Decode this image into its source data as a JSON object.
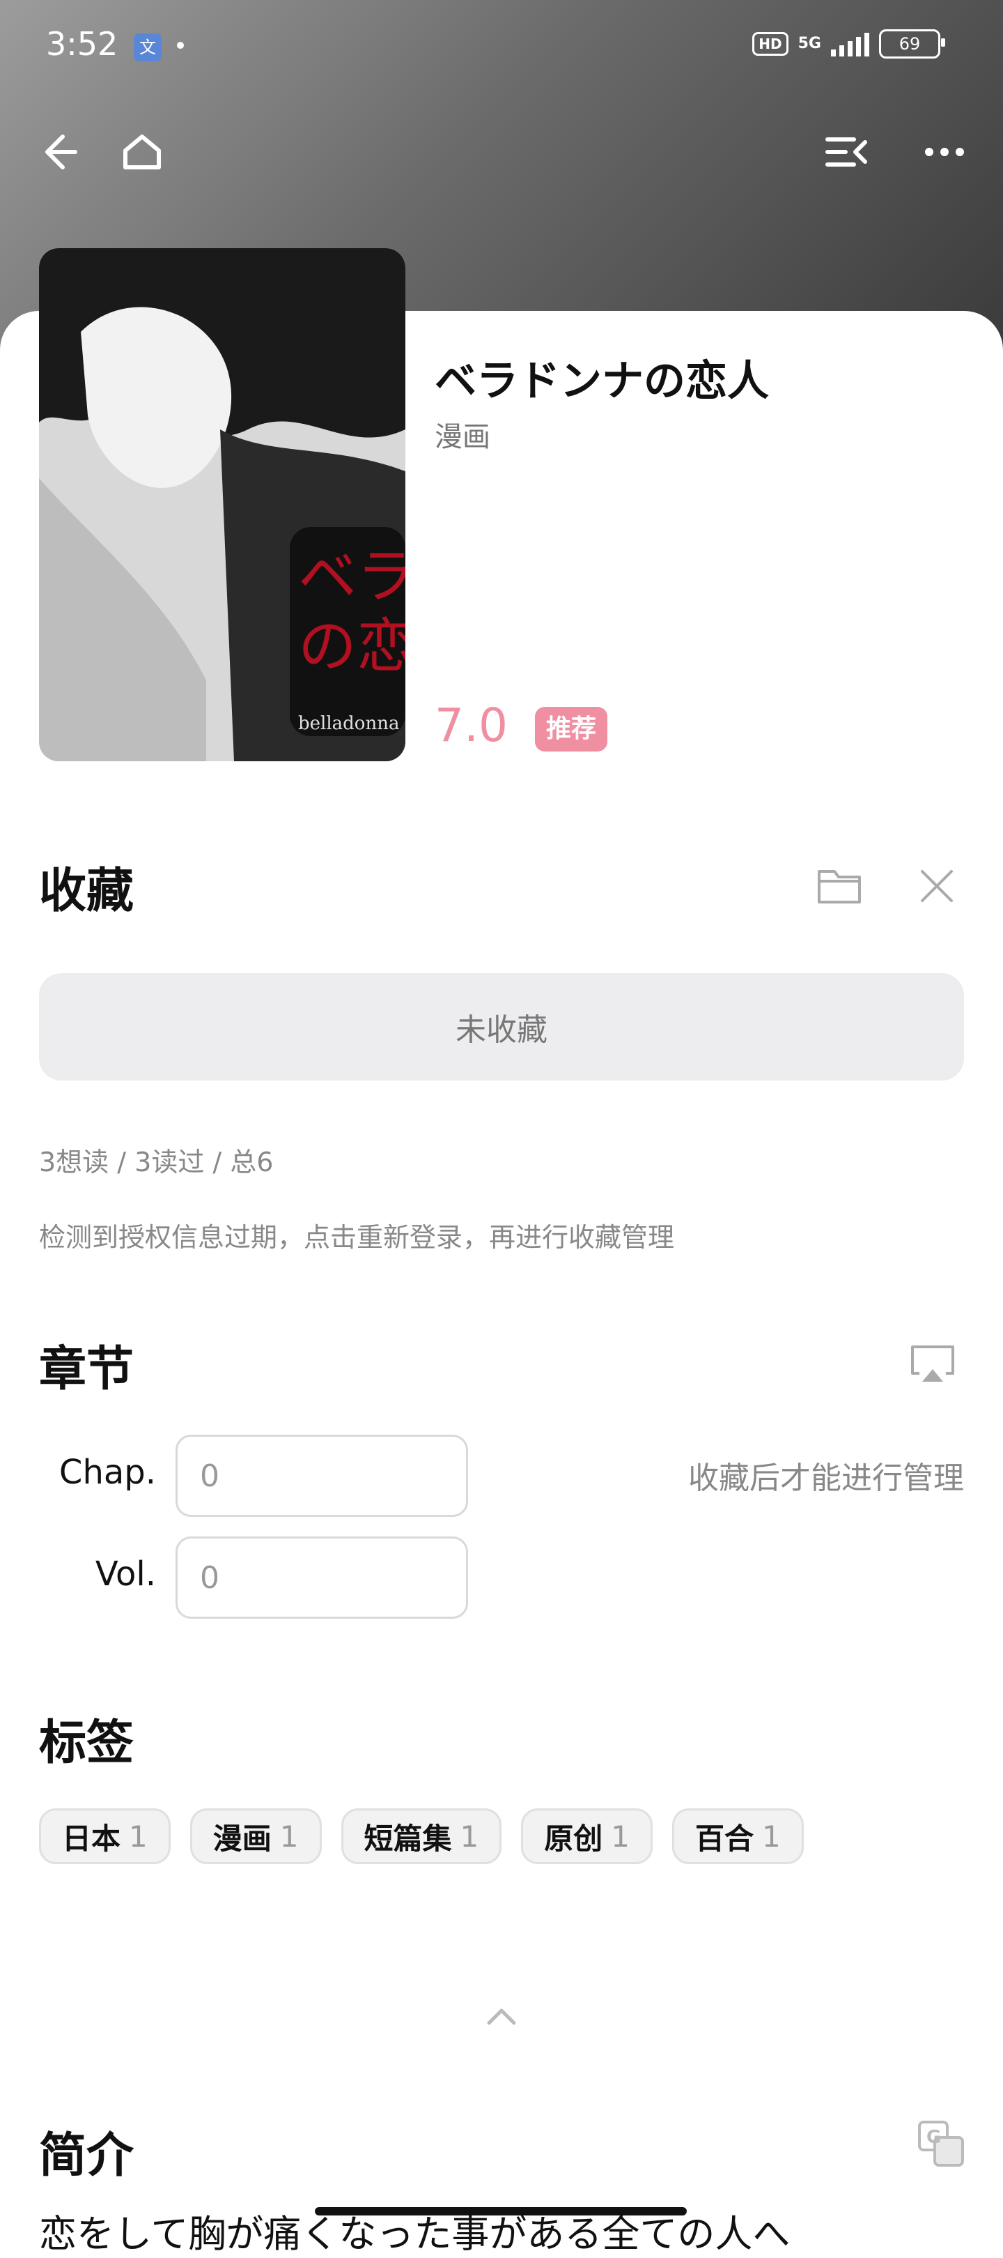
{
  "status_bar": {
    "time": "3:52",
    "app_icon": "文",
    "hd": "HD",
    "network": "5G",
    "battery": "69"
  },
  "nav": {
    "back_icon": "arrow-left-icon",
    "home_icon": "home-icon",
    "menu_icon": "list-collapse-icon",
    "more_icon": "more-horizontal-icon"
  },
  "book": {
    "title": "ベラドンナの恋人",
    "type": "漫画",
    "score": "7.0",
    "badge": "推荐",
    "cover_text": "ベラドンナの恋人",
    "cover_sub": "belladonna"
  },
  "collection": {
    "heading": "收藏",
    "status_button": "未收藏",
    "stats": "3想读 / 3读过 / 总6",
    "auth_hint": "检测到授权信息过期，点击重新登录，再进行收藏管理"
  },
  "chapters": {
    "heading": "章节",
    "chap_label": "Chap.",
    "chap_placeholder": "0",
    "vol_label": "Vol.",
    "vol_placeholder": "0",
    "manage_hint": "收藏后才能进行管理"
  },
  "tags": {
    "heading": "标签",
    "items": [
      {
        "name": "日本",
        "count": "1"
      },
      {
        "name": "漫画",
        "count": "1"
      },
      {
        "name": "短篇集",
        "count": "1"
      },
      {
        "name": "原创",
        "count": "1"
      },
      {
        "name": "百合",
        "count": "1"
      }
    ]
  },
  "synopsis": {
    "heading": "简介",
    "text": "恋をして胸が痛くなった事がある全ての人へ"
  },
  "colors": {
    "accent": "#f08ea2",
    "muted": "#888888"
  }
}
